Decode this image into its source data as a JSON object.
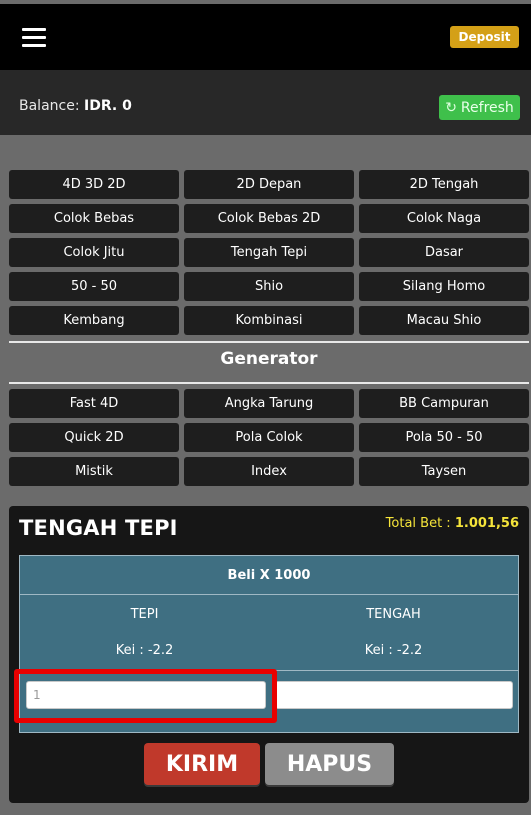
{
  "header": {
    "deposit_label": "Deposit"
  },
  "balance": {
    "label": "Balance:",
    "value": "IDR. 0",
    "refresh_label": "Refresh"
  },
  "games": [
    "4D 3D 2D",
    "2D Depan",
    "2D Tengah",
    "Colok Bebas",
    "Colok Bebas 2D",
    "Colok Naga",
    "Colok Jitu",
    "Tengah Tepi",
    "Dasar",
    "50 - 50",
    "Shio",
    "Silang Homo",
    "Kembang",
    "Kombinasi",
    "Macau Shio"
  ],
  "generator": {
    "title": "Generator",
    "items": [
      "Fast 4D",
      "Angka Tarung",
      "BB Campuran",
      "Quick 2D",
      "Pola Colok",
      "Pola 50 - 50",
      "Mistik",
      "Index",
      "Taysen"
    ]
  },
  "panel": {
    "title": "TENGAH TEPI",
    "total_bet_label": "Total Bet :",
    "total_bet_value": "1.001,56",
    "table_header": "Beli X 1000",
    "columns": [
      {
        "name": "TEPI",
        "kei": "Kei : -2.2"
      },
      {
        "name": "TENGAH",
        "kei": "Kei : -2.2"
      }
    ],
    "inputs": [
      "1",
      ""
    ],
    "kirim_label": "KIRIM",
    "hapus_label": "HAPUS"
  },
  "colors": {
    "deposit": "#d4a017",
    "refresh": "#3fc04b",
    "kirim": "#c0392b",
    "hapus": "#8c8c8c",
    "table": "#3f6f82",
    "highlight": "#e80000"
  }
}
